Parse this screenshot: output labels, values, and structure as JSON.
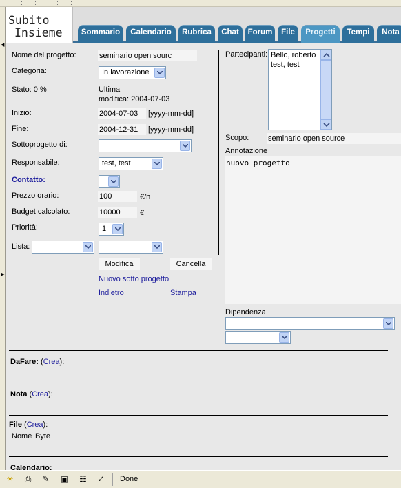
{
  "logo": {
    "line1": "Subito",
    "line2": "Insieme"
  },
  "tabs": [
    {
      "label": "Sommario",
      "active": false
    },
    {
      "label": "Calendario",
      "active": false
    },
    {
      "label": "Rubrica",
      "active": false
    },
    {
      "label": "Chat",
      "active": false
    },
    {
      "label": "Forum",
      "active": false
    },
    {
      "label": "File",
      "active": false
    },
    {
      "label": "Progetti",
      "active": true
    },
    {
      "label": "Tempi",
      "active": false
    },
    {
      "label": "Nota",
      "active": false
    }
  ],
  "form": {
    "nome_label": "Nome del progetto:",
    "nome_value": "seminario open sourc",
    "categoria_label": "Categoria:",
    "categoria_value": "In lavorazione",
    "stato_label": "Stato: 0 %",
    "ultima_line1": "Ultima",
    "ultima_line2": "modifica: 2004-07-03",
    "inizio_label": "Inizio:",
    "inizio_value": "2004-07-03",
    "inizio_hint": "[yyyy-mm-dd]",
    "fine_label": "Fine:",
    "fine_value": "2004-12-31",
    "fine_hint": "[yyyy-mm-dd]",
    "sotto_label": "Sottoprogetto di:",
    "sotto_value": "",
    "resp_label": "Responsabile:",
    "resp_value": "test, test",
    "contatto_label": "Contatto:",
    "contatto_value": "",
    "prezzo_label": "Prezzo orario:",
    "prezzo_value": "100",
    "prezzo_unit": "€/h",
    "budget_label": "Budget calcolato:",
    "budget_value": "10000",
    "budget_unit": "€",
    "priorita_label": "Priorità:",
    "priorita_value": "1",
    "lista_label": "Lista:",
    "lista_value1": "",
    "lista_value2": "",
    "modifica_btn": "Modifica",
    "cancella_btn": "Cancella",
    "nuovo_link": "Nuovo sotto progetto",
    "indietro_link": "Indietro",
    "stampa_link": "Stampa"
  },
  "right": {
    "partecipanti_label": "Partecipanti:",
    "partecipanti": [
      "Bello, roberto",
      "test, test"
    ],
    "scopo_label": "Scopo:",
    "scopo_value": "seminario open source",
    "annotazione_label": "Annotazione",
    "annotazione_value": "nuovo progetto",
    "dipendenza_label": "Dipendenza",
    "dipendenza_value1": "",
    "dipendenza_value2": ""
  },
  "sections": {
    "dafare_label": "DaFare:",
    "nota_label": "Nota",
    "file_label": "File",
    "crea_open": "(",
    "crea": "Crea",
    "crea_close": "):",
    "file_col1": "Nome",
    "file_col2": "Byte",
    "calendario_label": "Calendario:"
  },
  "status": {
    "text": "Done"
  }
}
